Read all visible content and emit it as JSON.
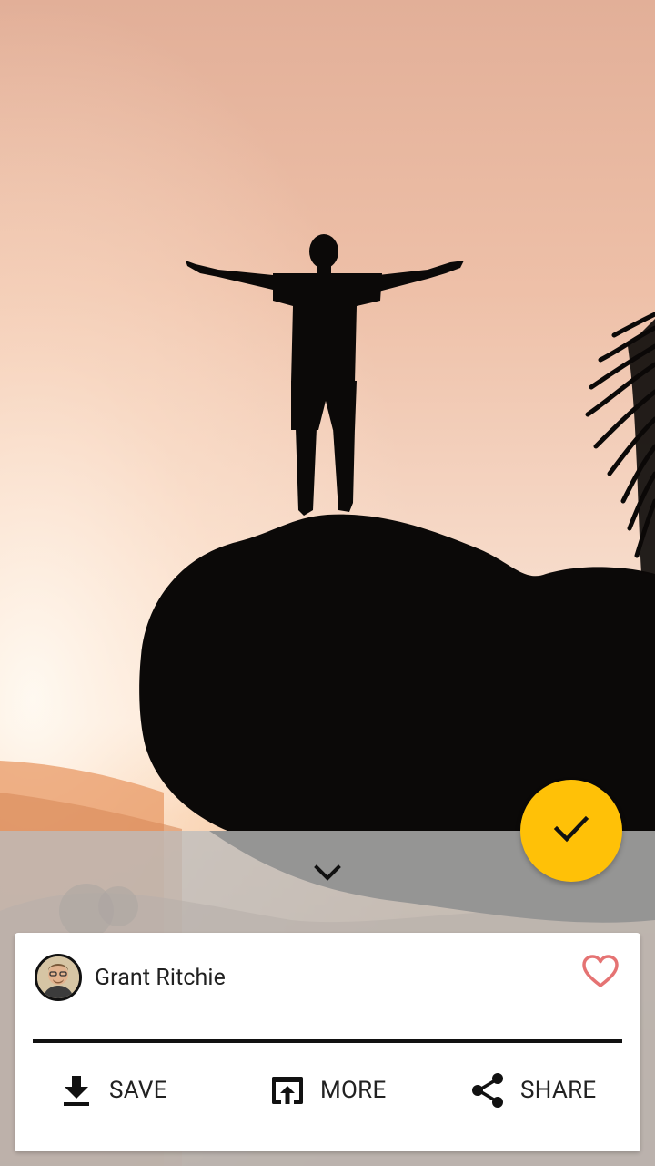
{
  "photo": {
    "subject": "silhouette-person-on-rock-at-sunset"
  },
  "fab": {
    "icon": "check-icon",
    "color": "#FFC107"
  },
  "collapse": {
    "icon": "chevron-down-icon"
  },
  "card": {
    "author": {
      "name": "Grant Ritchie",
      "avatar_icon": "avatar"
    },
    "like": {
      "icon": "heart-outline-icon",
      "color": "#E57373"
    },
    "actions": [
      {
        "label": "SAVE",
        "icon": "download-icon"
      },
      {
        "label": "MORE",
        "icon": "open-in-browser-icon"
      },
      {
        "label": "SHARE",
        "icon": "share-icon"
      }
    ]
  }
}
